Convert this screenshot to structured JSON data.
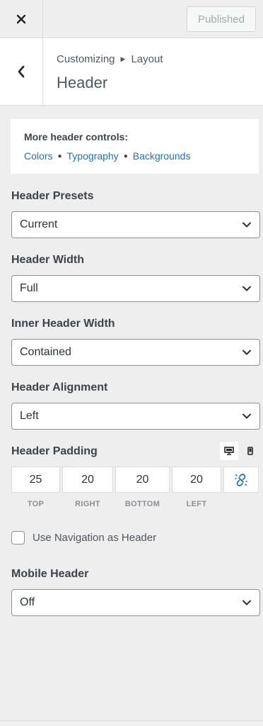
{
  "topbar": {
    "close_icon": "close-icon",
    "publish_label": "Published"
  },
  "section": {
    "breadcrumb_parent": "Customizing",
    "breadcrumb_child": "Layout",
    "title": "Header"
  },
  "info": {
    "title": "More header controls:",
    "links": [
      "Colors",
      "Typography",
      "Backgrounds"
    ]
  },
  "controls": {
    "presets": {
      "label": "Header Presets",
      "value": "Current"
    },
    "width": {
      "label": "Header Width",
      "value": "Full"
    },
    "inner_width": {
      "label": "Inner Header Width",
      "value": "Contained"
    },
    "alignment": {
      "label": "Header Alignment",
      "value": "Left"
    },
    "padding": {
      "label": "Header Padding",
      "values": [
        "25",
        "20",
        "20",
        "20"
      ],
      "sides": [
        "TOP",
        "RIGHT",
        "BOTTOM",
        "LEFT"
      ],
      "devices": [
        "desktop-icon",
        "mobile-icon"
      ]
    },
    "nav_as_header": {
      "label": "Use Navigation as Header",
      "checked": false
    },
    "mobile_header": {
      "label": "Mobile Header",
      "value": "Off"
    }
  },
  "colors": {
    "link": "#2271b1",
    "background": "#eeeeee"
  }
}
